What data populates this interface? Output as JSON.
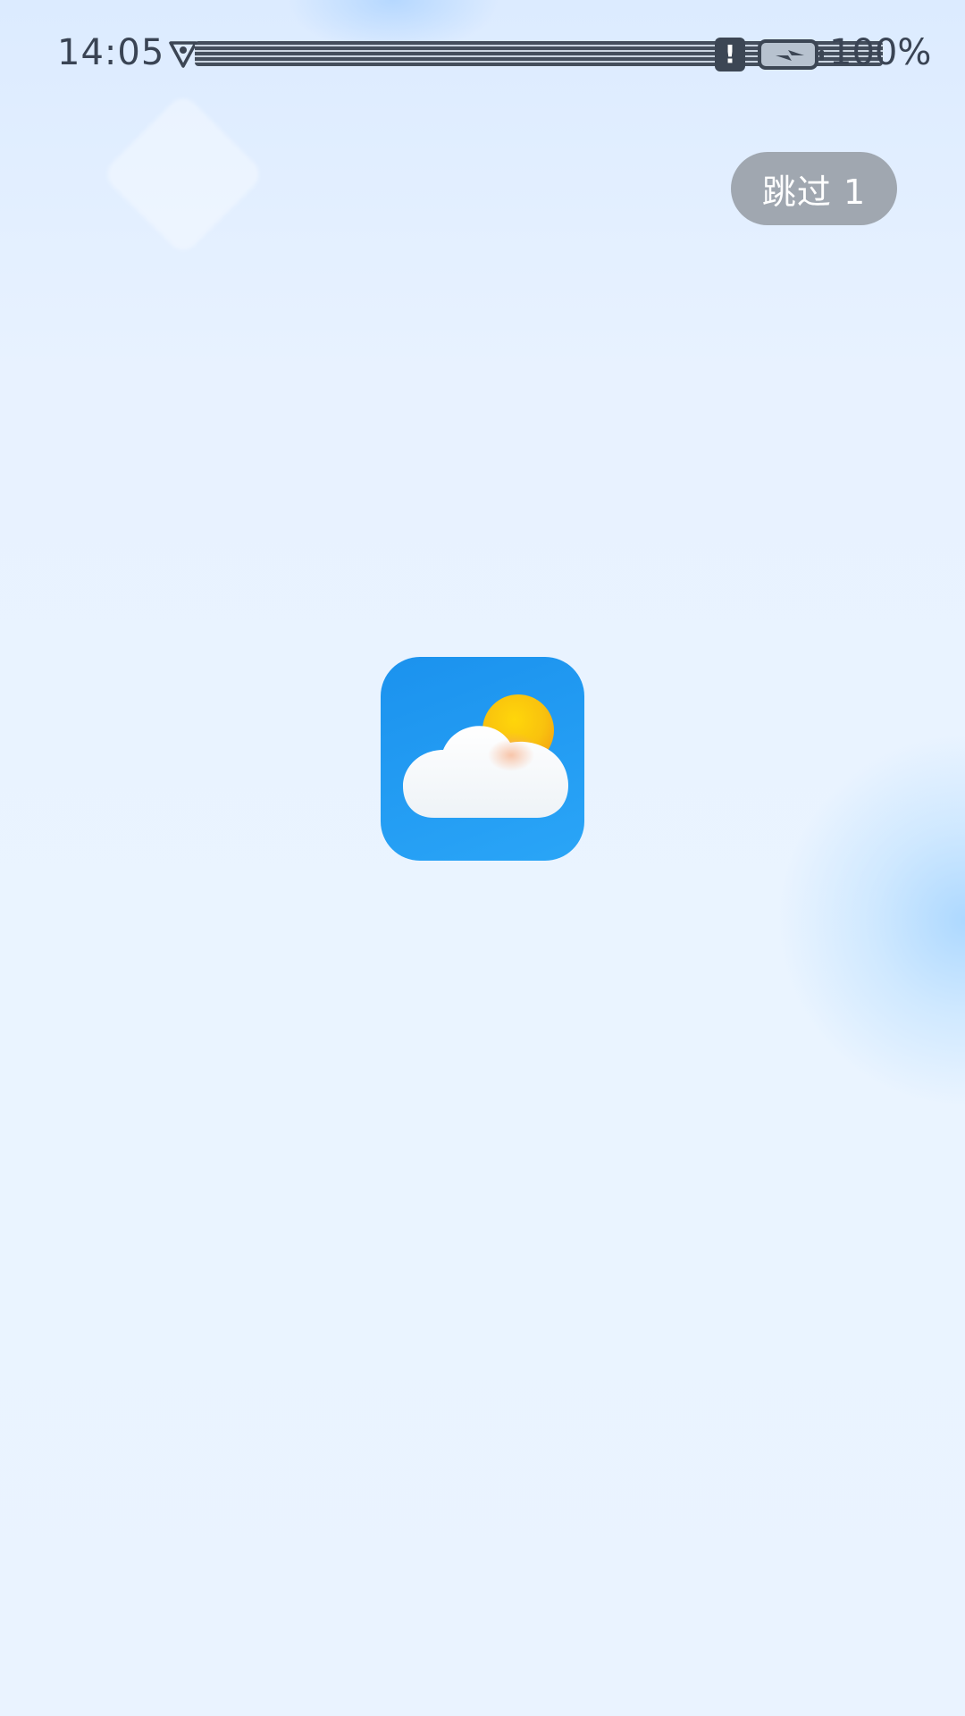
{
  "status_bar": {
    "time": "14:05",
    "battery_percent": "100%",
    "icons": [
      "shield-icon",
      "alert-icon",
      "battery-charging-icon"
    ]
  },
  "splash": {
    "skip_label": "跳过 1",
    "app_icon": "weather-cloud-sun-icon"
  },
  "colors": {
    "background": "#EAF3FF",
    "icon_blue": "#1B92EE",
    "sun_yellow": "#F9C80E",
    "skip_button_bg": "#A0A7B0",
    "status_text": "#3A4454"
  }
}
